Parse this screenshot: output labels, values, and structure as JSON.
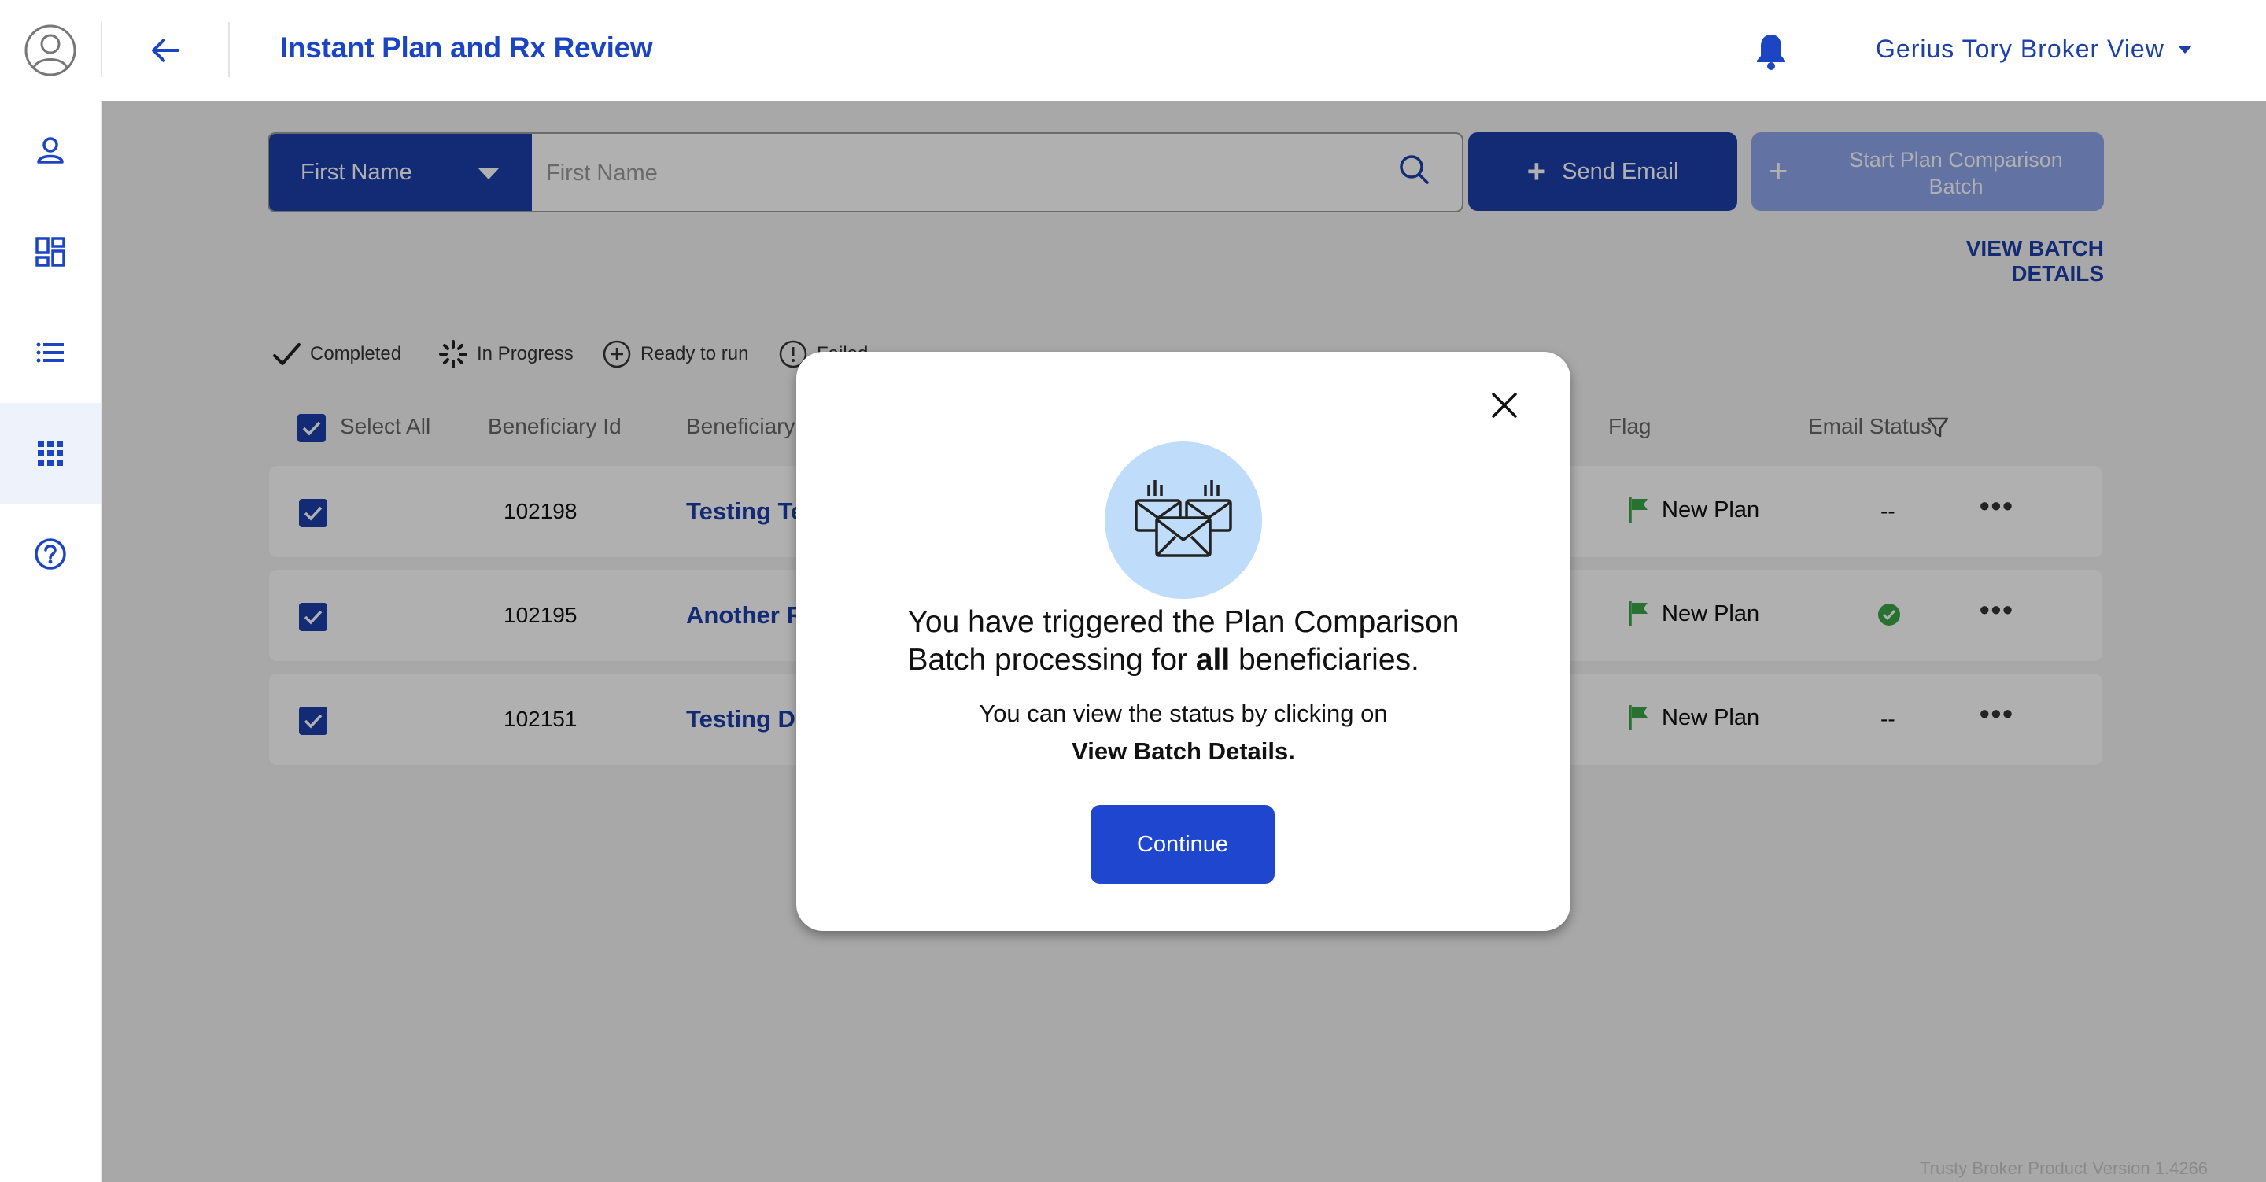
{
  "header": {
    "title": "Instant Plan and Rx Review",
    "user_name": "Gerius Tory Broker View"
  },
  "sidebar": {
    "items": [
      {
        "icon": "person-icon",
        "active": false
      },
      {
        "icon": "dashboard-icon",
        "active": false
      },
      {
        "icon": "list-icon",
        "active": false
      },
      {
        "icon": "apps-grid-icon",
        "active": true
      },
      {
        "icon": "help-icon",
        "active": false
      }
    ]
  },
  "search": {
    "field_select": "First Name",
    "placeholder": "First Name",
    "value": ""
  },
  "toolbar": {
    "send_email_label": "Send Email",
    "start_batch_label_line1": "Start Plan Comparison",
    "start_batch_label_line2": "Batch",
    "view_batch_label": "VIEW BATCH DETAILS"
  },
  "legend": {
    "completed": "Completed",
    "in_progress": "In Progress",
    "ready": "Ready to run",
    "failed": "Failed"
  },
  "table": {
    "columns": {
      "select_all": "Select All",
      "beneficiary_id": "Beneficiary Id",
      "beneficiary": "Beneficiary",
      "flag": "Flag",
      "email_status": "Email Status"
    },
    "rows": [
      {
        "checked": true,
        "id": "102198",
        "name": "Testing Te",
        "flag": "New Plan",
        "email_status": "--"
      },
      {
        "checked": true,
        "id": "102195",
        "name": "Another R",
        "flag": "New Plan",
        "email_status": "sent"
      },
      {
        "checked": true,
        "id": "102151",
        "name": "Testing DE",
        "flag": "New Plan",
        "email_status": "--"
      }
    ]
  },
  "footer": {
    "version": "Trusty Broker Product Version 1.4266"
  },
  "modal": {
    "message_line1": "You have triggered the Plan Comparison",
    "message_line2_pre": "Batch processing for ",
    "message_line2_bold": "all",
    "message_line2_post": " beneficiaries.",
    "sub_line1": "You can view the status by clicking on",
    "sub_line2": "View Batch Details.",
    "continue_label": "Continue"
  },
  "colors": {
    "primary": "#1c3fa8",
    "primary_light": "#8da5ec",
    "continue": "#1f46cf",
    "flag_green": "#3aa548",
    "illus_bg": "#bfdcfb"
  }
}
